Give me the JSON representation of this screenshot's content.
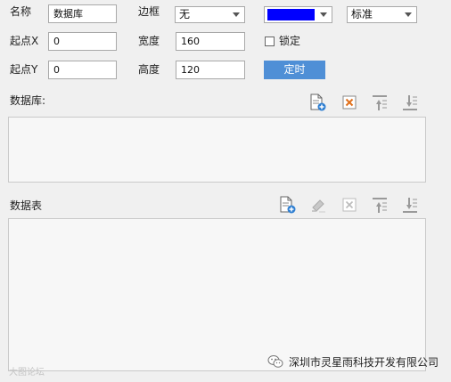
{
  "form": {
    "name_label": "名称",
    "name_value": "数据库",
    "border_label": "边框",
    "border_value": "无",
    "color_value": "#0000ff",
    "style_value": "标准",
    "x_label": "起点X",
    "x_value": "0",
    "width_label": "宽度",
    "width_value": "160",
    "lock_label": "锁定",
    "lock_checked": false,
    "y_label": "起点Y",
    "y_value": "0",
    "height_label": "高度",
    "height_value": "120",
    "timer_button": "定时"
  },
  "database_section": {
    "title": "数据库:"
  },
  "table_section": {
    "title": "数据表"
  },
  "footer": {
    "company": "深圳市灵星雨科技开发有限公司",
    "faint": "大图论坛"
  }
}
